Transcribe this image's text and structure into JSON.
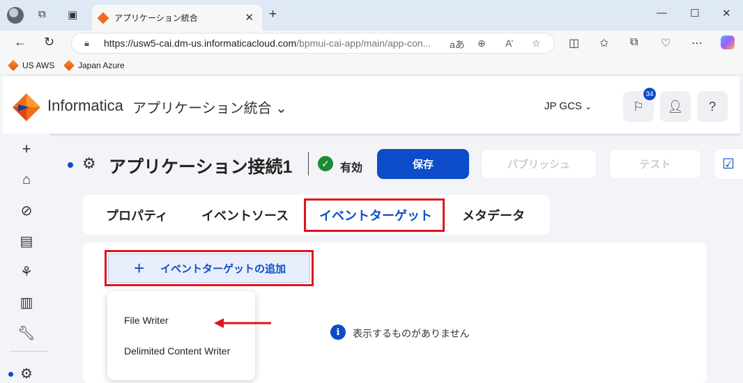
{
  "browser": {
    "tab_title": "アプリケーション統合",
    "url_host": "https://usw5-cai.dm-us.informaticacloud.com",
    "url_path": "/bpmui-cai-app/main/app-con...",
    "bookmarks": [
      "US AWS",
      "Japan Azure"
    ],
    "text_size_label": "aあ",
    "read_aloud_label": "A’"
  },
  "header": {
    "brand": "Informatica",
    "module": "アプリケーション統合",
    "org": "JP GCS",
    "notification_count": "34",
    "help_label": "?"
  },
  "page": {
    "title": "アプリケーション接続1",
    "status": "有効",
    "save_label": "保存",
    "publish_label": "パブリッシュ",
    "test_label": "テスト"
  },
  "tabs": [
    "プロパティ",
    "イベントソース",
    "イベントターゲット",
    "メタデータ"
  ],
  "selected_tab": "イベントターゲット",
  "panel": {
    "add_button_label": "イベントターゲットの追加",
    "menu_items": [
      "File Writer",
      "Delimited Content Writer"
    ],
    "empty_message": "表示するものがありません"
  },
  "colors": {
    "accent": "#0c4cc8",
    "highlight": "#e0141e",
    "status_ok": "#1a8a35"
  },
  "icons": {
    "nav": [
      "plus-icon",
      "home-icon",
      "compass-icon",
      "document-icon",
      "graph-icon",
      "clipboard-icon",
      "wrench-icon",
      "gears-icon"
    ]
  }
}
